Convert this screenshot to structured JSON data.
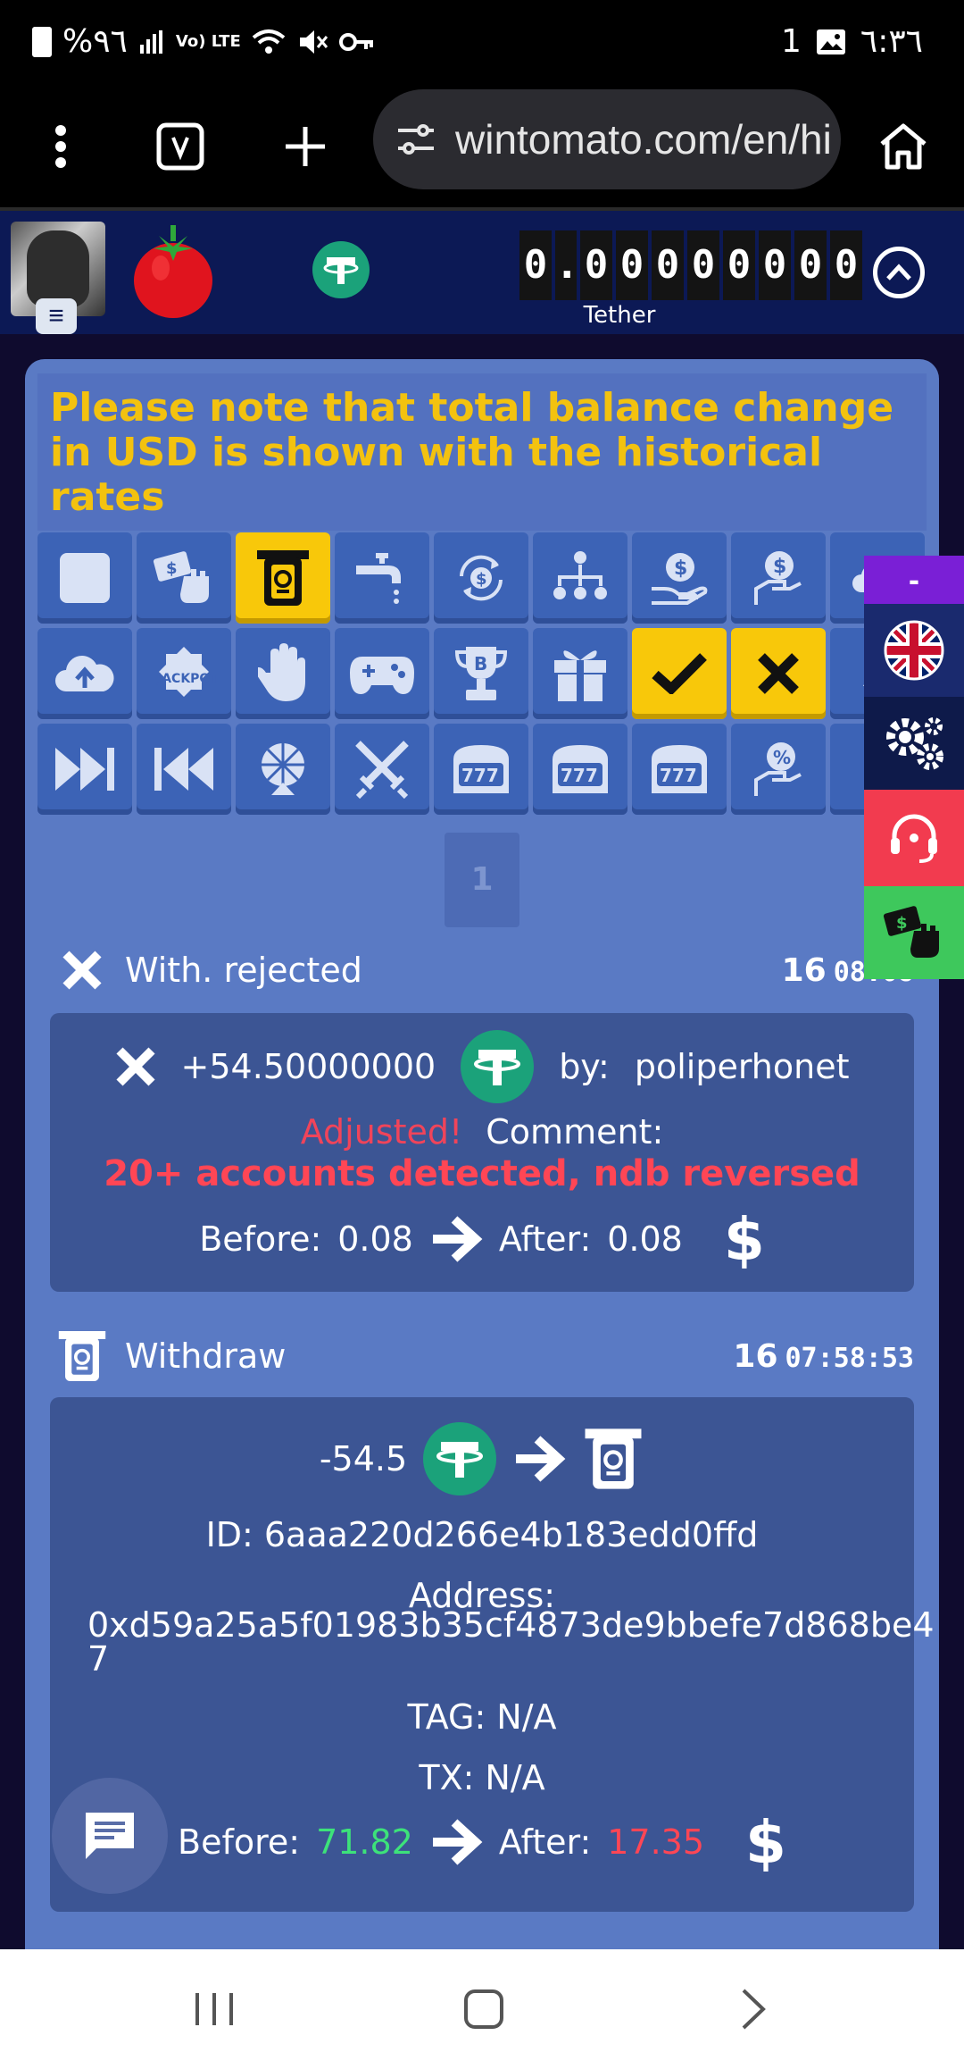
{
  "status_bar": {
    "battery": "%٩٦",
    "signal": "Vo) LTE",
    "right_num": "1",
    "time": "٦:٣٦"
  },
  "browser": {
    "url": "wintomato.com/en/hi"
  },
  "header": {
    "balance_digits": [
      "0",
      ".",
      "0",
      "0",
      "0",
      "0",
      "0",
      "0",
      "0",
      "0"
    ],
    "currency_label": "Tether",
    "jackpot_text": "JACKPOT"
  },
  "notice": "Please note that total balance change in USD is shown with the historical rates",
  "pager": {
    "current": "1"
  },
  "dock": {
    "collapse_label": "-"
  },
  "entries": [
    {
      "type": "With. rejected",
      "date_day": "16",
      "date_time": "08:08",
      "amount": "+54.50000000",
      "by_label": "by:",
      "by_user": "poliperhonet",
      "adjusted": "Adjusted!",
      "comment_label": "Comment:",
      "comment": "20+ accounts detected, ndb reversed",
      "before_label": "Before:",
      "before": "0.08",
      "after_label": "After:",
      "after": "0.08",
      "currency_symbol": "$"
    },
    {
      "type": "Withdraw",
      "date_day": "16",
      "date_time": "07:58:53",
      "amount": "-54.5",
      "id_label": "ID:",
      "id": "6aaa220d266e4b183edd0ffd",
      "address_label": "Address:",
      "address": "0xd59a25a5f01983b35cf4873de9bbefe7d868be4",
      "address_tail": "7",
      "tag_label": "TAG:",
      "tag": "N/A",
      "tx_label": "TX:",
      "tx": "N/A",
      "before_label": "Before:",
      "before": "71.82",
      "after_label": "After:",
      "after": "17.35",
      "currency_symbol": "$"
    }
  ],
  "colors": {
    "accent_yellow": "#f8c80a",
    "panel_blue": "#5a7ac4",
    "card_blue": "#3c5594",
    "red": "#ff4655",
    "green": "#3de27a"
  }
}
